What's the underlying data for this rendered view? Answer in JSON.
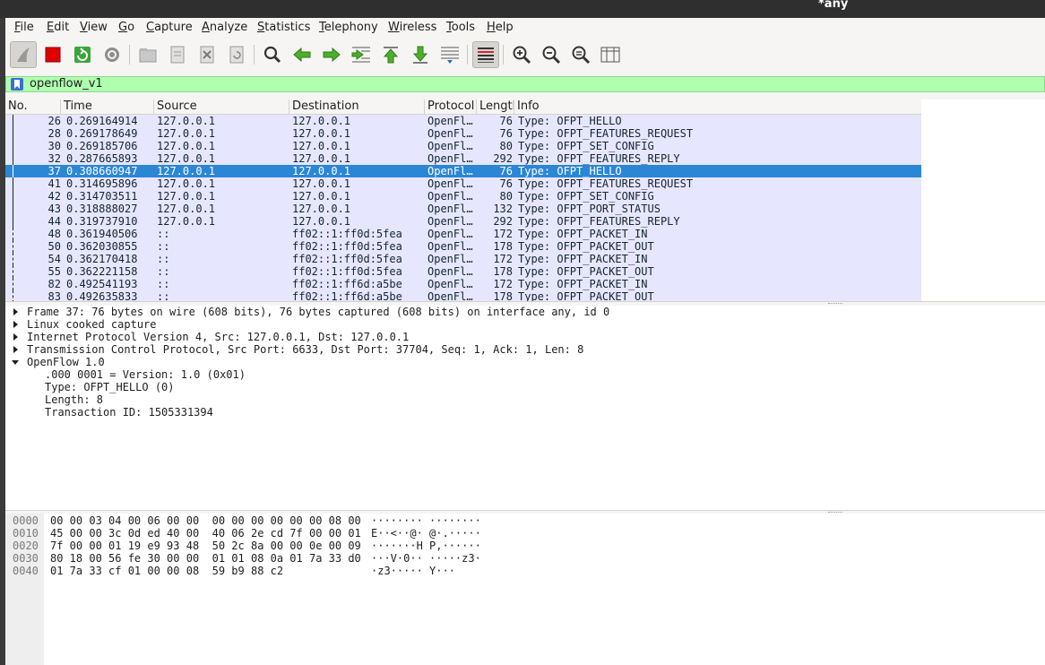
{
  "window": {
    "title": "*any"
  },
  "menu": [
    "File",
    "Edit",
    "View",
    "Go",
    "Capture",
    "Analyze",
    "Statistics",
    "Telephony",
    "Wireless",
    "Tools",
    "Help"
  ],
  "filter": {
    "value": "openflow_v1"
  },
  "columns": [
    "No.",
    "Time",
    "Source",
    "Destination",
    "Protocol",
    "Length",
    "Info"
  ],
  "packets": [
    {
      "no": "26",
      "time": "0.269164914",
      "src": "127.0.0.1",
      "dst": "127.0.0.1",
      "proto": "OpenFl…",
      "len": "76",
      "info": "Type: OFPT_HELLO"
    },
    {
      "no": "28",
      "time": "0.269178649",
      "src": "127.0.0.1",
      "dst": "127.0.0.1",
      "proto": "OpenFl…",
      "len": "76",
      "info": "Type: OFPT_FEATURES_REQUEST"
    },
    {
      "no": "30",
      "time": "0.269185706",
      "src": "127.0.0.1",
      "dst": "127.0.0.1",
      "proto": "OpenFl…",
      "len": "80",
      "info": "Type: OFPT_SET_CONFIG"
    },
    {
      "no": "32",
      "time": "0.287665893",
      "src": "127.0.0.1",
      "dst": "127.0.0.1",
      "proto": "OpenFl…",
      "len": "292",
      "info": "Type: OFPT_FEATURES_REPLY"
    },
    {
      "no": "37",
      "time": "0.308660947",
      "src": "127.0.0.1",
      "dst": "127.0.0.1",
      "proto": "OpenFl…",
      "len": "76",
      "info": "Type: OFPT_HELLO"
    },
    {
      "no": "41",
      "time": "0.314695896",
      "src": "127.0.0.1",
      "dst": "127.0.0.1",
      "proto": "OpenFl…",
      "len": "76",
      "info": "Type: OFPT_FEATURES_REQUEST"
    },
    {
      "no": "42",
      "time": "0.314703511",
      "src": "127.0.0.1",
      "dst": "127.0.0.1",
      "proto": "OpenFl…",
      "len": "80",
      "info": "Type: OFPT_SET_CONFIG"
    },
    {
      "no": "43",
      "time": "0.318888027",
      "src": "127.0.0.1",
      "dst": "127.0.0.1",
      "proto": "OpenFl…",
      "len": "132",
      "info": "Type: OFPT_PORT_STATUS"
    },
    {
      "no": "44",
      "time": "0.319737910",
      "src": "127.0.0.1",
      "dst": "127.0.0.1",
      "proto": "OpenFl…",
      "len": "292",
      "info": "Type: OFPT_FEATURES_REPLY"
    },
    {
      "no": "48",
      "time": "0.361940506",
      "src": "::",
      "dst": "ff02::1:ff0d:5fea",
      "proto": "OpenFl…",
      "len": "172",
      "info": "Type: OFPT_PACKET_IN"
    },
    {
      "no": "50",
      "time": "0.362030855",
      "src": "::",
      "dst": "ff02::1:ff0d:5fea",
      "proto": "OpenFl…",
      "len": "178",
      "info": "Type: OFPT_PACKET_OUT"
    },
    {
      "no": "54",
      "time": "0.362170418",
      "src": "::",
      "dst": "ff02::1:ff0d:5fea",
      "proto": "OpenFl…",
      "len": "172",
      "info": "Type: OFPT_PACKET_IN"
    },
    {
      "no": "55",
      "time": "0.362221158",
      "src": "::",
      "dst": "ff02::1:ff0d:5fea",
      "proto": "OpenFl…",
      "len": "178",
      "info": "Type: OFPT_PACKET_OUT"
    },
    {
      "no": "82",
      "time": "0.492541193",
      "src": "::",
      "dst": "ff02::1:ff6d:a5be",
      "proto": "OpenFl…",
      "len": "172",
      "info": "Type: OFPT_PACKET_IN"
    },
    {
      "no": "83",
      "time": "0.492635833",
      "src": "::",
      "dst": "ff02::1:ff6d:a5be",
      "proto": "OpenFl…",
      "len": "178",
      "info": "Type: OFPT_PACKET_OUT"
    }
  ],
  "selected_packet": "37",
  "details": [
    {
      "text": "Frame 37: 76 bytes on wire (608 bits), 76 bytes captured (608 bits) on interface any, id 0",
      "expander": "collapsed"
    },
    {
      "text": "Linux cooked capture",
      "expander": "collapsed"
    },
    {
      "text": "Internet Protocol Version 4, Src: 127.0.0.1, Dst: 127.0.0.1",
      "expander": "collapsed"
    },
    {
      "text": "Transmission Control Protocol, Src Port: 6633, Dst Port: 37704, Seq: 1, Ack: 1, Len: 8",
      "expander": "collapsed"
    },
    {
      "text": "OpenFlow 1.0",
      "expander": "expanded"
    },
    {
      "text": ".000 0001 = Version: 1.0 (0x01)",
      "expander": "none"
    },
    {
      "text": "Type: OFPT_HELLO (0)",
      "expander": "none"
    },
    {
      "text": "Length: 8",
      "expander": "none"
    },
    {
      "text": "Transaction ID: 1505331394",
      "expander": "none"
    }
  ],
  "bytes": [
    {
      "offset": "0000",
      "hex": "00 00 03 04 00 06 00 00  00 00 00 00 00 00 08 00",
      "ascii": "········ ········"
    },
    {
      "offset": "0010",
      "hex": "45 00 00 3c 0d ed 40 00  40 06 2e cd 7f 00 00 01",
      "ascii": "E··<··@· @·.·····"
    },
    {
      "offset": "0020",
      "hex": "7f 00 00 01 19 e9 93 48  50 2c 8a 00 00 0e 00 09",
      "ascii": "·······H P,······"
    },
    {
      "offset": "0030",
      "hex": "80 18 00 56 fe 30 00 00  01 01 08 0a 01 7a 33 d0",
      "ascii": "···V·0·· ·····z3·"
    },
    {
      "offset": "0040",
      "hex": "01 7a 33 cf 01 00 00 08  59 b9 88 c2",
      "ascii": "·z3····· Y···"
    }
  ],
  "toolbar_icons": [
    "shark-fin-icon",
    "stop-capture-icon",
    "restart-capture-icon",
    "capture-options-icon",
    "open-file-icon",
    "save-file-icon",
    "close-file-icon",
    "reload-file-icon",
    "find-packet-icon",
    "go-back-icon",
    "go-forward-icon",
    "go-to-packet-icon",
    "first-packet-icon",
    "last-packet-icon",
    "autoscroll-icon",
    "colorize-icon",
    "zoom-in-icon",
    "zoom-out-icon",
    "normal-size-icon",
    "resize-columns-icon"
  ],
  "colors": {
    "filter_valid_bg": "#afffaf",
    "row_bg": "#e7e6ff",
    "row_selected_bg": "#2b86d6",
    "stop_red": "#e00000"
  }
}
